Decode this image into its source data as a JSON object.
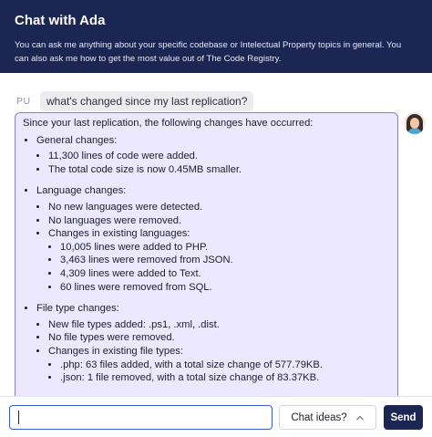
{
  "header": {
    "title": "Chat with Ada",
    "description": "You can ask me anything about your specific codebase or Intelectual Property topics in general. You can also ask me how to get the most value out of The Code Registry."
  },
  "conversation": {
    "user": {
      "avatar_initials": "PU",
      "message": "what's changed since my last replication?"
    },
    "assistant": {
      "avatar_icon": "ada-avatar-icon",
      "intro": "Since your last replication, the following changes have occurred:",
      "general": {
        "title": "General changes:",
        "items": [
          "11,300 lines of code were added.",
          "The total code size is now 0.45MB smaller."
        ]
      },
      "language": {
        "title": "Language changes:",
        "items": [
          "No new languages were detected.",
          "No languages were removed."
        ],
        "existing_title": "Changes in existing languages:",
        "existing_items": [
          "10,005 lines were added to PHP.",
          "3,463 lines were removed from JSON.",
          "4,309 lines were added to Text.",
          "60 lines were removed from SQL."
        ]
      },
      "file_type": {
        "title": "File type changes:",
        "items": [
          "New file types added: .ps1, .xml, .dist.",
          "No file types were removed."
        ],
        "existing_title": "Changes in existing file types:",
        "existing_items": [
          ".php: 63 files added, with a total size change of 577.79KB.",
          ".json: 1 file removed, with a total size change of 83.37KB."
        ]
      }
    }
  },
  "footer": {
    "input_value": "",
    "ideas_label": "Chat ideas?",
    "send_label": "Send"
  },
  "colors": {
    "header_bg": "#1b2653",
    "assistant_bubble_bg": "#ece8ff",
    "assistant_bubble_border": "#8b7bd3",
    "input_border": "#3b5bdb",
    "send_bg": "#1b2653"
  }
}
